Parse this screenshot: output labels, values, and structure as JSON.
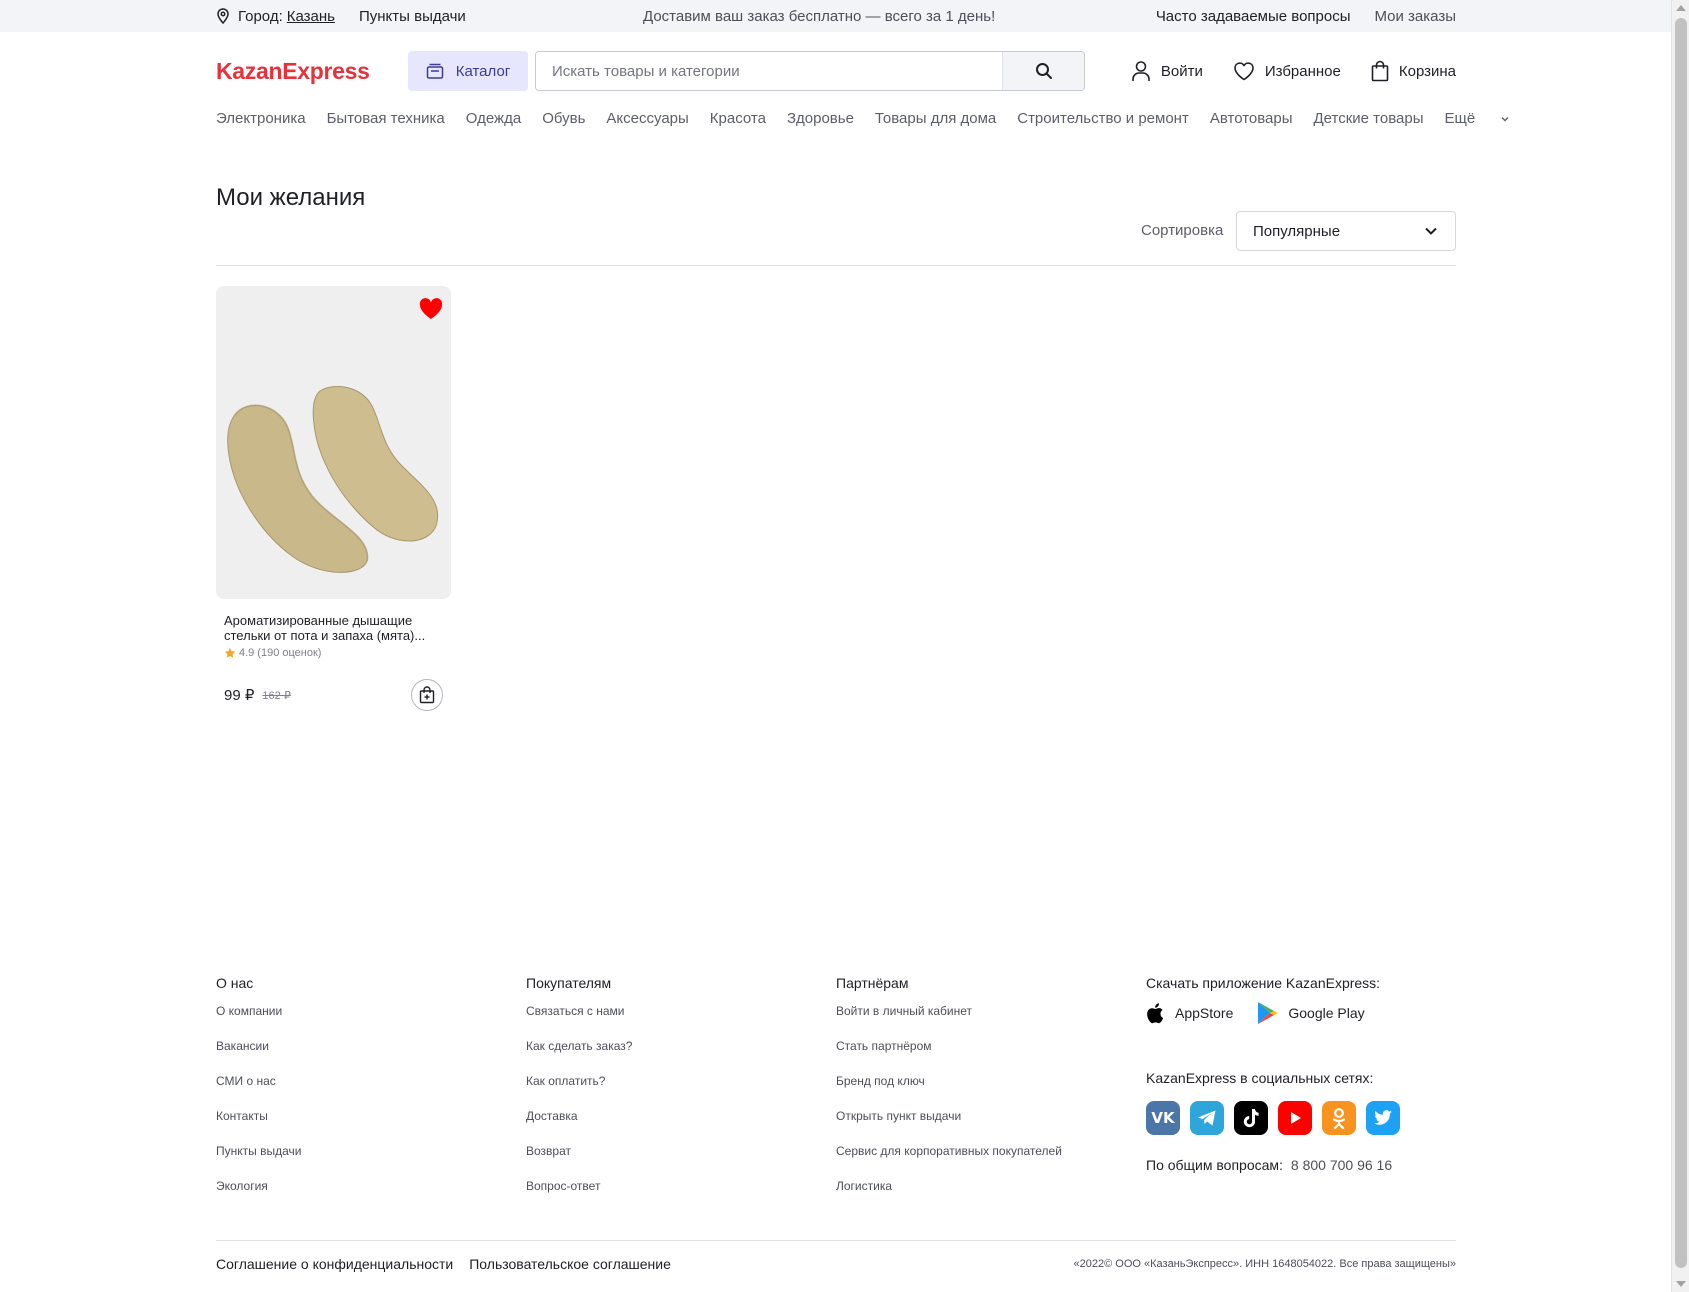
{
  "topbar": {
    "city_label": "Город:",
    "city_value": "Казань",
    "pickup_points": "Пункты выдачи",
    "promo": "Доставим ваш заказ бесплатно — всего за 1 день!",
    "faq": "Часто задаваемые вопросы",
    "my_orders": "Мои заказы"
  },
  "header": {
    "logo": "KazanExpress",
    "catalog_label": "Каталог",
    "search_placeholder": "Искать товары и категории",
    "login_label": "Войти",
    "favorites_label": "Избранное",
    "cart_label": "Корзина"
  },
  "categories": [
    "Электроника",
    "Бытовая техника",
    "Одежда",
    "Обувь",
    "Аксессуары",
    "Красота",
    "Здоровье",
    "Товары для дома",
    "Строительство и ремонт",
    "Автотовары",
    "Детские товары"
  ],
  "categories_more": "Ещё",
  "page": {
    "title": "Мои желания",
    "sort_label": "Сортировка",
    "sort_value": "Популярные"
  },
  "product": {
    "title": "Ароматизированные дышащие стельки от пота и запаха (мята)...",
    "rating": "4.9",
    "reviews": "(190 оценок)",
    "price": "99 ₽",
    "old_price": "162 ₽",
    "favorited": true
  },
  "footer": {
    "about": {
      "title": "О нас",
      "links": [
        "О компании",
        "Вакансии",
        "СМИ о нас",
        "Контакты",
        "Пункты выдачи",
        "Экология"
      ]
    },
    "buyers": {
      "title": "Покупателям",
      "links": [
        "Связаться с нами",
        "Как сделать заказ?",
        "Как оплатить?",
        "Доставка",
        "Возврат",
        "Вопрос-ответ"
      ]
    },
    "partners": {
      "title": "Партнёрам",
      "links": [
        "Войти в личный кабинет",
        "Стать партнёром",
        "Бренд под ключ",
        "Открыть пункт выдачи",
        "Сервис для корпоративных покупателей",
        "Логистика"
      ]
    },
    "apps_title": "Скачать приложение KazanExpress:",
    "appstore": "AppStore",
    "googleplay": "Google Play",
    "social_title": "KazanExpress в социальных сетях:",
    "socials": [
      {
        "name": "vk-icon",
        "color": "#4a76a8"
      },
      {
        "name": "telegram-icon",
        "color": "#2ea6da"
      },
      {
        "name": "tiktok-icon",
        "color": "#000000"
      },
      {
        "name": "youtube-icon",
        "color": "#ff0000"
      },
      {
        "name": "odnoklassniki-icon",
        "color": "#f7931e"
      },
      {
        "name": "twitter-icon",
        "color": "#1da1f2"
      }
    ],
    "phone_label": "По общим вопросам:",
    "phone": "8 800 700 96 16",
    "privacy": "Соглашение о конфиденциальности",
    "user_agreement": "Пользовательское соглашение",
    "copyright": "«2022© ООО «КазаньЭкспресс». ИНН 1648054022. Все права защищены»"
  },
  "colors": {
    "brand": "#e8313a",
    "catalog_bg": "#e6e6fe",
    "heart": "#ff0000",
    "star": "#f5a623"
  }
}
